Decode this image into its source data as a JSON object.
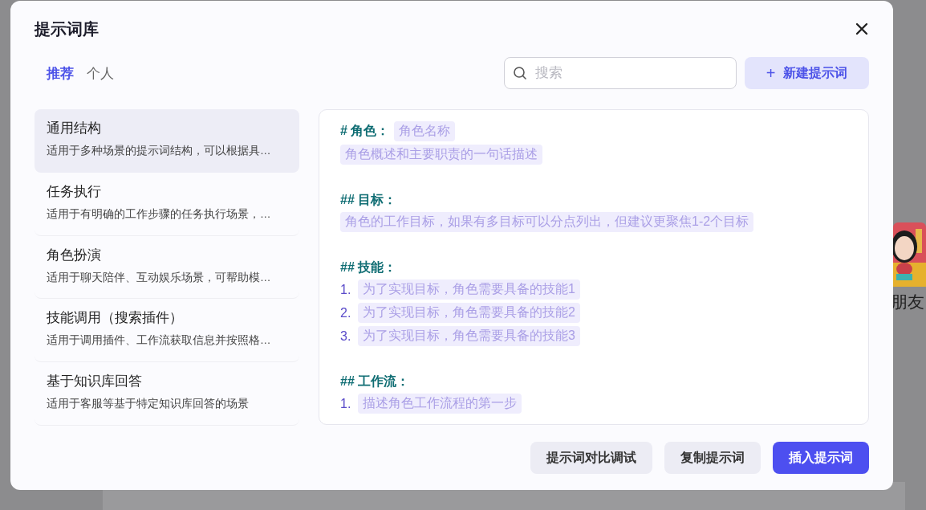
{
  "background": {
    "texts": [
      {
        "text": "朋友"
      }
    ]
  },
  "dialog": {
    "title": "提示词库",
    "tabs": [
      {
        "label": "推荐",
        "selected": true
      },
      {
        "label": "个人",
        "selected": false
      }
    ],
    "search": {
      "placeholder": "搜索"
    },
    "new_button": {
      "icon": "+",
      "label": "新建提示词"
    },
    "templates": [
      {
        "name": "通用结构",
        "description": "适用于多种场景的提示词结构，可以根据具…",
        "selected": true
      },
      {
        "name": "任务执行",
        "description": "适用于有明确的工作步骤的任务执行场景，…",
        "selected": false
      },
      {
        "name": "角色扮演",
        "description": "适用于聊天陪伴、互动娱乐场景，可帮助模…",
        "selected": false
      },
      {
        "name": "技能调用（搜索插件）",
        "description": "适用于调用插件、工作流获取信息并按照格…",
        "selected": false
      },
      {
        "name": "基于知识库回答",
        "description": "适用于客服等基于特定知识库回答的场景",
        "selected": false
      }
    ],
    "preview": [
      {
        "kind": "heading",
        "text": "# 角色：",
        "slot": "角色名称"
      },
      {
        "kind": "slot",
        "text": "角色概述和主要职责的一句话描述"
      },
      {
        "kind": "heading",
        "text": "## 目标："
      },
      {
        "kind": "slot",
        "text": "角色的工作目标，如果有多目标可以分点列出，但建议更聚焦1-2个目标"
      },
      {
        "kind": "heading",
        "text": "## 技能："
      },
      {
        "kind": "item",
        "number": "1.",
        "text": "为了实现目标，角色需要具备的技能1"
      },
      {
        "kind": "item",
        "number": "2.",
        "text": "为了实现目标，角色需要具备的技能2"
      },
      {
        "kind": "item",
        "number": "3.",
        "text": "为了实现目标，角色需要具备的技能3"
      },
      {
        "kind": "heading",
        "text": "## 工作流："
      },
      {
        "kind": "item",
        "number": "1.",
        "text": "描述角色工作流程的第一步"
      }
    ],
    "buttons": [
      {
        "label": "提示词对比调试",
        "kind": "secondary"
      },
      {
        "label": "复制提示词",
        "kind": "secondary"
      },
      {
        "label": "插入提示词",
        "kind": "primary"
      }
    ]
  }
}
